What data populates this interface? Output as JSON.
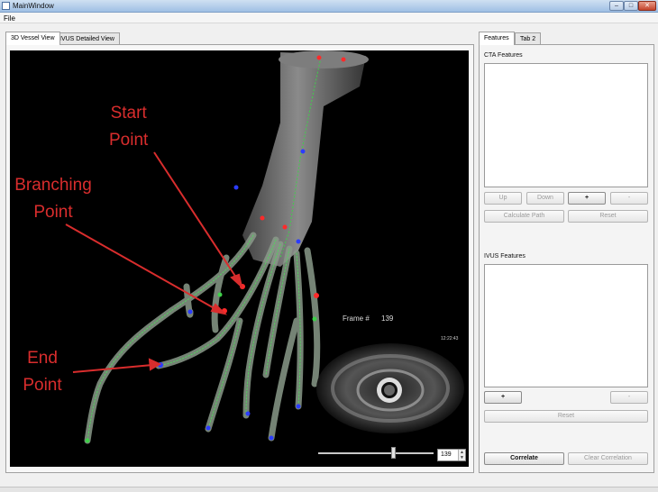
{
  "window": {
    "title": "MainWindow",
    "controls": {
      "minimize": "–",
      "maximize": "□",
      "close": "✕"
    }
  },
  "menu": {
    "file": "File"
  },
  "left_tabs": [
    {
      "label": "3D Vessel View",
      "active": true
    },
    {
      "label": "IVUS Detailed View",
      "active": false
    }
  ],
  "annotations": {
    "start_point": [
      "Start",
      "Point"
    ],
    "branching_point": [
      "Branching",
      "Point"
    ],
    "end_point": [
      "End",
      "Point"
    ],
    "color": "#d92d2d"
  },
  "ivus_overlay": {
    "frame_label": "Frame #",
    "frame_number": "139",
    "timestamp": "12:22:43"
  },
  "slider": {
    "value": "139",
    "fraction": 0.66
  },
  "right_tabs": [
    {
      "label": "Features",
      "active": true
    },
    {
      "label": "Tab 2",
      "active": false
    }
  ],
  "cta": {
    "label": "CTA Features",
    "up": "Up",
    "down": "Down",
    "add": "+",
    "remove": "-",
    "calculate_path": "Calculate Path",
    "reset": "Reset"
  },
  "ivus": {
    "label": "IVUS Features",
    "add": "+",
    "remove": "-",
    "reset": "Reset"
  },
  "footer": {
    "correlate": "Correlate",
    "clear_correlation": "Clear Correlation"
  },
  "icons": [
    "app-icon",
    "spin-up-icon",
    "spin-down-icon"
  ]
}
